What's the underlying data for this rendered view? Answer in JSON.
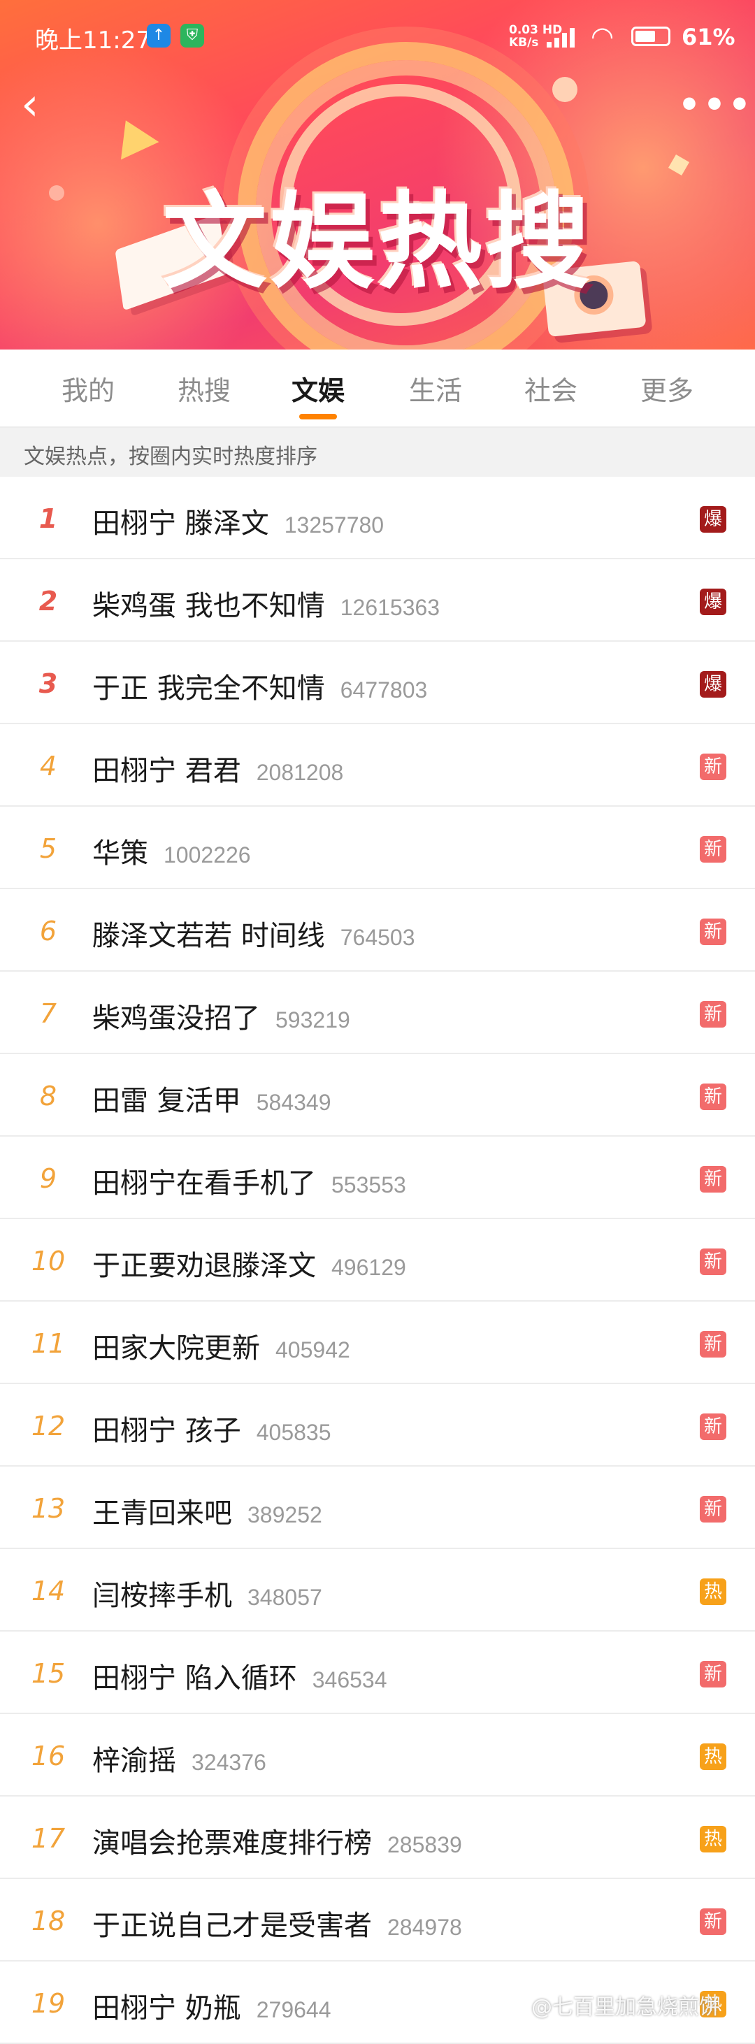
{
  "status_bar": {
    "time": "晚上11:27",
    "net_speed_line1": "0.03 HD",
    "net_speed_line2": "KB/s",
    "battery": "61%"
  },
  "banner": {
    "title": "文娱热搜"
  },
  "nav": {
    "back_icon": "chevron-left-icon",
    "more_label": "•••"
  },
  "tabs": [
    {
      "label": "我的"
    },
    {
      "label": "热搜"
    },
    {
      "label": "文娱"
    },
    {
      "label": "生活"
    },
    {
      "label": "社会"
    },
    {
      "label": "更多"
    }
  ],
  "active_tab": "文娱",
  "subheader": "文娱热点，按圈内实时热度排序",
  "badge_colors": {
    "爆": "#a31b1b",
    "新": "#f26b6b",
    "热": "#f7a11a"
  },
  "items": [
    {
      "rank": "1",
      "title": "田栩宁 滕泽文",
      "heat": "13257780",
      "badge": "爆"
    },
    {
      "rank": "2",
      "title": "柴鸡蛋 我也不知情",
      "heat": "12615363",
      "badge": "爆"
    },
    {
      "rank": "3",
      "title": "于正 我完全不知情",
      "heat": "6477803",
      "badge": "爆"
    },
    {
      "rank": "4",
      "title": "田栩宁 君君",
      "heat": "2081208",
      "badge": "新"
    },
    {
      "rank": "5",
      "title": "华策",
      "heat": "1002226",
      "badge": "新"
    },
    {
      "rank": "6",
      "title": "滕泽文若若 时间线",
      "heat": "764503",
      "badge": "新"
    },
    {
      "rank": "7",
      "title": "柴鸡蛋没招了",
      "heat": "593219",
      "badge": "新"
    },
    {
      "rank": "8",
      "title": "田雷 复活甲",
      "heat": "584349",
      "badge": "新"
    },
    {
      "rank": "9",
      "title": "田栩宁在看手机了",
      "heat": "553553",
      "badge": "新"
    },
    {
      "rank": "10",
      "title": "于正要劝退滕泽文",
      "heat": "496129",
      "badge": "新"
    },
    {
      "rank": "11",
      "title": "田家大院更新",
      "heat": "405942",
      "badge": "新"
    },
    {
      "rank": "12",
      "title": "田栩宁 孩子",
      "heat": "405835",
      "badge": "新"
    },
    {
      "rank": "13",
      "title": "王青回来吧",
      "heat": "389252",
      "badge": "新"
    },
    {
      "rank": "14",
      "title": "闫桉摔手机",
      "heat": "348057",
      "badge": "热"
    },
    {
      "rank": "15",
      "title": "田栩宁 陷入循环",
      "heat": "346534",
      "badge": "新"
    },
    {
      "rank": "16",
      "title": "梓渝摇",
      "heat": "324376",
      "badge": "热"
    },
    {
      "rank": "17",
      "title": "演唱会抢票难度排行榜",
      "heat": "285839",
      "badge": "热"
    },
    {
      "rank": "18",
      "title": "于正说自己才是受害者",
      "heat": "284978",
      "badge": "新"
    },
    {
      "rank": "19",
      "title": "田栩宁 奶瓶",
      "heat": "279644",
      "badge": "热"
    }
  ],
  "watermark": "@七百里加急烧煎饼"
}
